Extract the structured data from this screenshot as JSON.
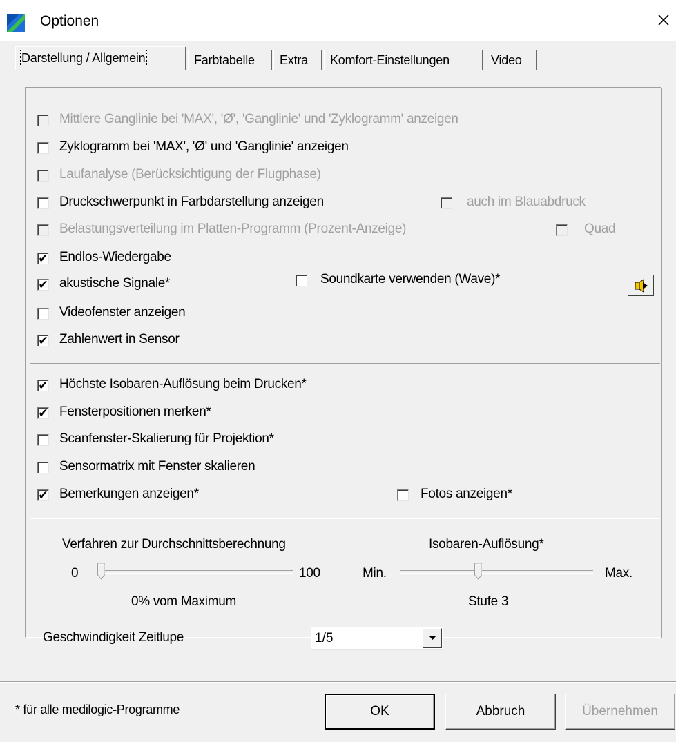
{
  "window": {
    "title": "Optionen"
  },
  "tabs": [
    {
      "label": "Darstellung / Allgemein",
      "active": true
    },
    {
      "label": "Farbtabelle",
      "active": false
    },
    {
      "label": "Extra",
      "active": false
    },
    {
      "label": "Komfort-Einstellungen",
      "active": false
    },
    {
      "label": "Video",
      "active": false
    }
  ],
  "options": {
    "mittlere_ganglinie": {
      "label": "Mittlere Ganglinie bei 'MAX', 'Ø', 'Ganglinie' und 'Zyklogramm' anzeigen",
      "checked": false,
      "enabled": false
    },
    "zyklogramm": {
      "label": "Zyklogramm bei 'MAX', 'Ø' und 'Ganglinie' anzeigen",
      "checked": false,
      "enabled": true
    },
    "laufanalyse": {
      "label": "Laufanalyse (Berücksichtigung der Flugphase)",
      "checked": false,
      "enabled": false
    },
    "druckschwerpunkt": {
      "label": "Druckschwerpunkt in Farbdarstellung anzeigen",
      "checked": false,
      "enabled": true
    },
    "blauabdruck": {
      "label": "auch im Blauabdruck",
      "checked": false,
      "enabled": false
    },
    "belastungsverteilung": {
      "label": "Belastungsverteilung im Platten-Programm (Prozent-Anzeige)",
      "checked": false,
      "enabled": false
    },
    "quad": {
      "label": "Quad",
      "checked": false,
      "enabled": false
    },
    "endlos": {
      "label": "Endlos-Wiedergabe",
      "checked": true,
      "enabled": true
    },
    "akustisch": {
      "label": "akustische Signale*",
      "checked": true,
      "enabled": true
    },
    "soundkarte": {
      "label": "Soundkarte verwenden (Wave)*",
      "checked": false,
      "enabled": true
    },
    "videofenster": {
      "label": "Videofenster anzeigen",
      "checked": false,
      "enabled": true
    },
    "zahlenwert": {
      "label": "Zahlenwert in Sensor",
      "checked": true,
      "enabled": true
    },
    "isobaren_druck": {
      "label": "Höchste Isobaren-Auflösung beim Drucken*",
      "checked": true,
      "enabled": true
    },
    "fensterpositionen": {
      "label": "Fensterpositionen merken*",
      "checked": true,
      "enabled": true
    },
    "scanfenster": {
      "label": "Scanfenster-Skalierung für Projektion*",
      "checked": false,
      "enabled": true
    },
    "sensormatrix": {
      "label": "Sensormatrix mit Fenster skalieren",
      "checked": false,
      "enabled": true
    },
    "bemerkungen": {
      "label": "Bemerkungen anzeigen*",
      "checked": true,
      "enabled": true
    },
    "fotos": {
      "label": "Fotos anzeigen*",
      "checked": false,
      "enabled": true
    }
  },
  "check_glyph": "✔",
  "sliders": {
    "durchschnitt": {
      "title": "Verfahren zur Durchschnittsberechnung",
      "min_label": "0",
      "max_label": "100",
      "value_fraction": 0.0,
      "caption": "0% vom Maximum"
    },
    "isobaren": {
      "title": "Isobaren-Auflösung*",
      "min_label": "Min.",
      "max_label": "Max.",
      "value_fraction": 0.4,
      "caption": "Stufe 3"
    }
  },
  "zeitlupe": {
    "label": "Geschwindigkeit Zeitlupe",
    "value": "1/5"
  },
  "footer": {
    "note": "* für alle medilogic-Programme",
    "ok": "OK",
    "cancel": "Abbruch",
    "apply": "Übernehmen"
  },
  "icons": {
    "app": "app-logo-icon",
    "close": "close-icon",
    "sound": "speaker-play-icon",
    "dropdown": "dropdown-arrow-icon"
  }
}
